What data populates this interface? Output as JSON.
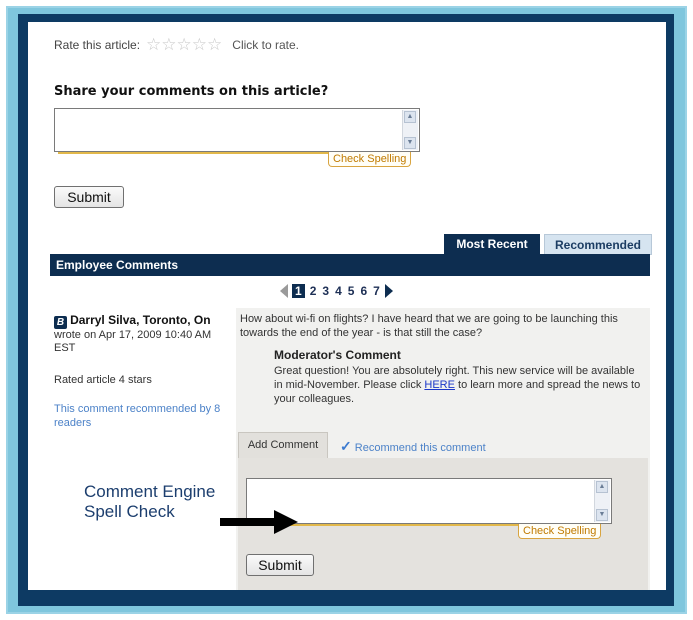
{
  "rating": {
    "label": "Rate this article:",
    "click_to_rate": "Click to rate.",
    "stars": 5
  },
  "share": {
    "title": "Share your comments on this article?",
    "spell_check_label": "Check Spelling",
    "submit_label": "Submit"
  },
  "tabs": [
    {
      "label": "Most Recent",
      "active": true
    },
    {
      "label": "Recommended",
      "active": false
    }
  ],
  "employee_comments": {
    "header": "Employee Comments"
  },
  "pager": {
    "pages": [
      "1",
      "2",
      "3",
      "4",
      "5",
      "6",
      "7"
    ],
    "current": "1"
  },
  "comment": {
    "author_badge": "B",
    "author_name": "Darryl Silva, Toronto, On",
    "wrote_on": "wrote on Apr 17, 2009 10:40 AM EST",
    "rated": "Rated article 4 stars",
    "recommended": "This comment recommended by 8 readers",
    "text": "How about wi-fi on flights? I have heard that we are going to be launching this towards the end of the year - is that still the case?",
    "moderator_title": "Moderator's Comment",
    "moderator_text_before": "Great question! You are absolutely right.  This new service will be available in mid-November.  Please click ",
    "moderator_link": "HERE",
    "moderator_text_after": " to learn more and spread the news to your colleagues."
  },
  "reply": {
    "add_comment_tab": "Add Comment",
    "recommend_link": "Recommend this comment",
    "spell_check_label": "Check Spelling",
    "submit_label": "Submit"
  },
  "annotation": {
    "line1": "Comment Engine",
    "line2": "Spell Check"
  },
  "colors": {
    "navy": "#0d2d50",
    "frame_blue": "#7fc6dd",
    "link_blue": "#4c82c8",
    "spell_gold": "#e2b84a"
  }
}
